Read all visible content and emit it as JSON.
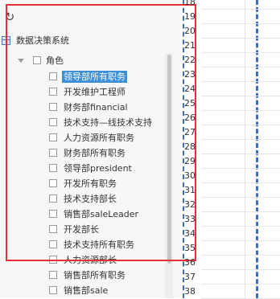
{
  "tree": {
    "root_label": "数据决策系统",
    "role_group_label": "角色",
    "items": [
      {
        "label": "领导部所有职务",
        "selected": true
      },
      {
        "label": "开发维护工程师",
        "selected": false
      },
      {
        "label": "财务部financial",
        "selected": false
      },
      {
        "label": "技术支持—线技术支持",
        "selected": false
      },
      {
        "label": "人力资源所有职务",
        "selected": false
      },
      {
        "label": "财务部所有职务",
        "selected": false
      },
      {
        "label": "领导部president",
        "selected": false
      },
      {
        "label": "开发所有职务",
        "selected": false
      },
      {
        "label": "技术支持部长",
        "selected": false
      },
      {
        "label": "销售部saleLeader",
        "selected": false
      },
      {
        "label": "开发部长",
        "selected": false
      },
      {
        "label": "技术支持所有职务",
        "selected": false
      },
      {
        "label": "人力资源部长",
        "selected": false
      },
      {
        "label": "销售部所有职务",
        "selected": false
      },
      {
        "label": "销售部sale",
        "selected": false
      }
    ]
  },
  "sheet": {
    "row_numbers": [
      "18",
      "19",
      "20",
      "21",
      "22",
      "23",
      "24",
      "25",
      "26",
      "27",
      "28",
      "29",
      "30",
      "31",
      "32",
      "33",
      "34",
      "35",
      "36",
      "37",
      "38"
    ]
  },
  "colors": {
    "selection": "#3d8fd6",
    "highlight_box": "#e5303a",
    "page_break": "#3b6fc0"
  },
  "icons": {
    "refresh": "refresh-icon",
    "root": "database-icon",
    "expand": "caret-down-icon"
  }
}
